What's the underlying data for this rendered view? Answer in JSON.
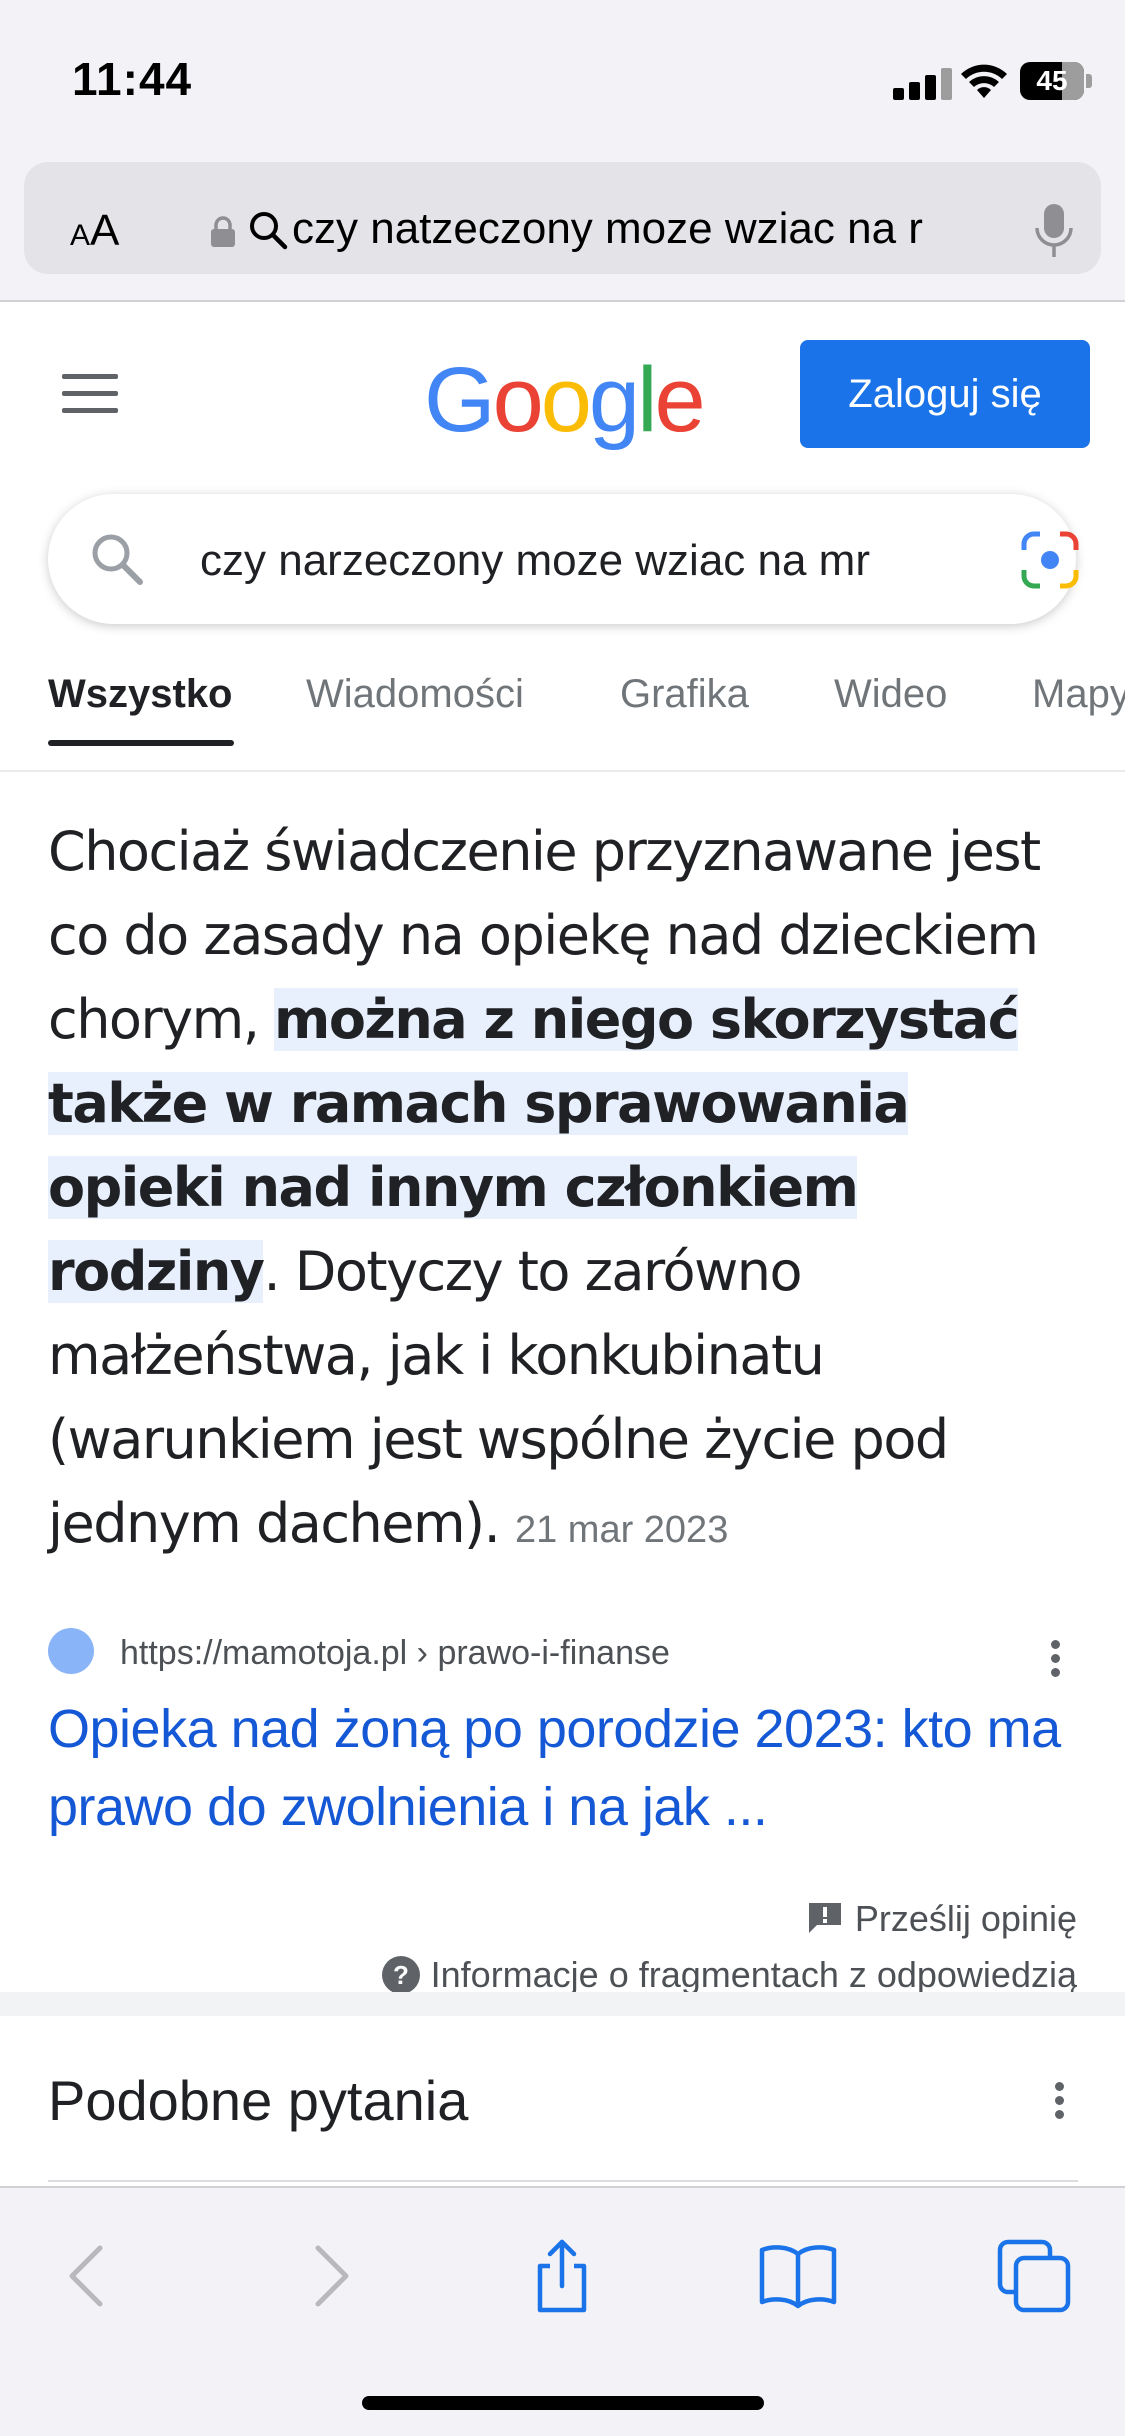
{
  "status_bar": {
    "time": "11:44",
    "battery": "45"
  },
  "address_bar": {
    "text_size_label": "AA",
    "url_text": "czy natzeczony moze wziac na r"
  },
  "header": {
    "logo_text": "Google",
    "login_label": "Zaloguj się"
  },
  "search": {
    "query": "czy narzeczony moze wziac na mr"
  },
  "tabs": [
    {
      "label": "Wszystko",
      "active": true
    },
    {
      "label": "Wiadomości"
    },
    {
      "label": "Grafika"
    },
    {
      "label": "Wideo"
    },
    {
      "label": "Mapy"
    }
  ],
  "snippet": {
    "text_before": "Chociaż świadczenie przyznawane jest co do zasady na opiekę nad dzieckiem chorym, ",
    "highlight": "można z niego skorzystać także w ramach sprawowania opieki nad innym członkiem rodziny",
    "text_after": ". Dotyczy to zarówno małżeństwa, jak i konkubinatu (warunkiem jest wspólne życie pod jednym dachem).",
    "date": "21 mar 2023"
  },
  "source": {
    "url": "https://mamotoja.pl › prawo-i-finanse",
    "title": "Opieka nad żoną po porodzie 2023: kto ma prawo do zwolnienia i na jak ..."
  },
  "feedback": {
    "send_label": "Prześlij opinię",
    "info_label": "Informacje o fragmentach z odpowiedzią"
  },
  "related": {
    "title": "Podobne pytania"
  },
  "colors": {
    "accent": "#1a73e8",
    "link": "#1558d6",
    "highlight": "#e8f0fe"
  }
}
